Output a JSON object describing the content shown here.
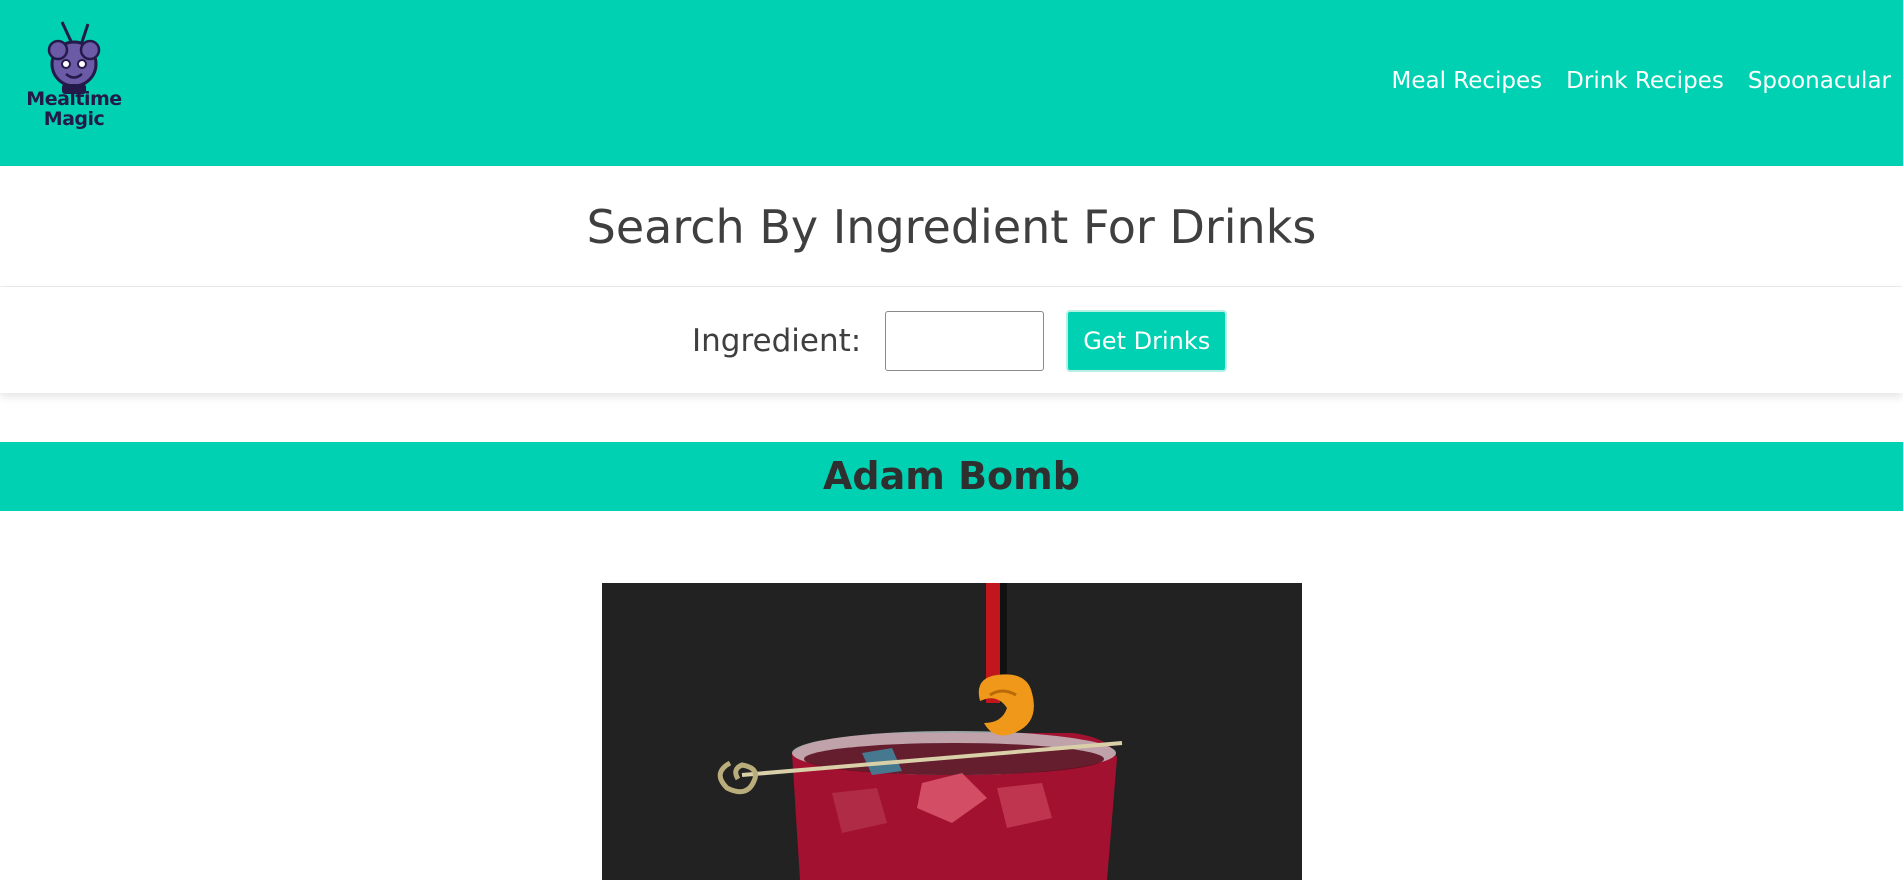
{
  "header": {
    "logo_lines": [
      "Mealtime",
      "Magic"
    ],
    "nav": [
      "Meal Recipes",
      "Drink Recipes",
      "Spoonacular"
    ]
  },
  "page": {
    "title": "Search By Ingredient For Drinks"
  },
  "search": {
    "label": "Ingredient:",
    "input_value": "",
    "button_label": "Get Drinks"
  },
  "result": {
    "name": "Adam Bomb"
  },
  "colors": {
    "accent": "#00d1b2",
    "text": "#3f3f3f",
    "logo_ink": "#241a4a",
    "image_bg": "#222222"
  }
}
